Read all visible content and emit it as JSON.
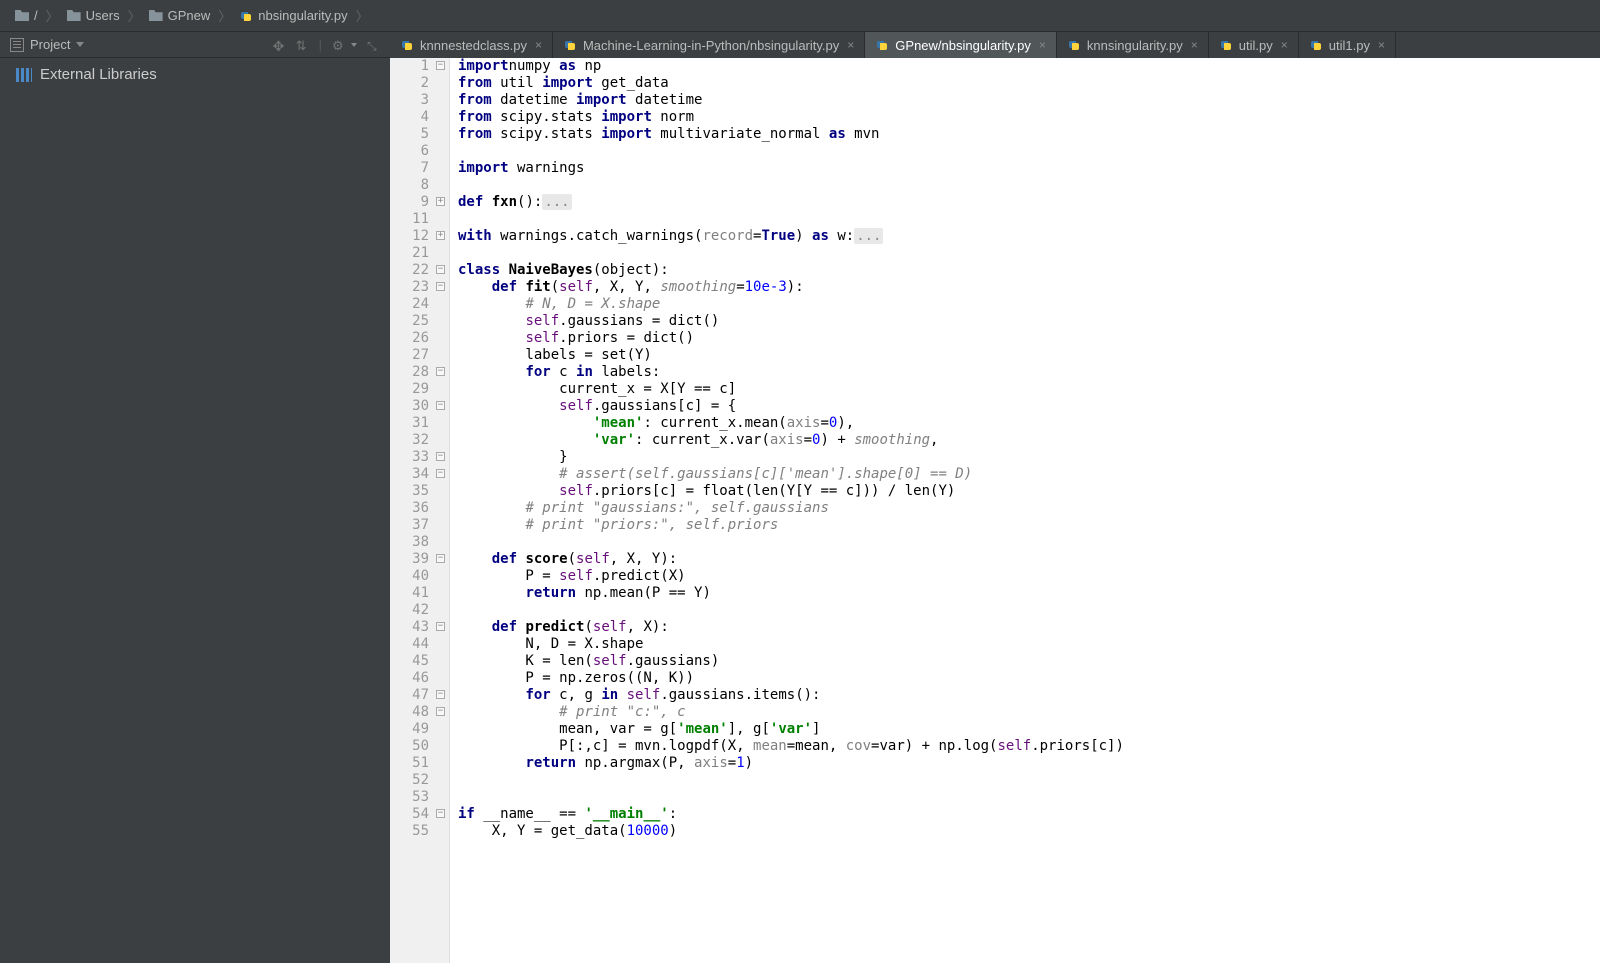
{
  "breadcrumb": [
    {
      "icon": "folder",
      "label": "/"
    },
    {
      "icon": "folder",
      "label": "Users"
    },
    {
      "icon": "folder",
      "label": "GPnew"
    },
    {
      "icon": "py",
      "label": "nbsingularity.py"
    }
  ],
  "sidebar": {
    "header_label": "Project",
    "external_label": "External Libraries"
  },
  "tabs": [
    {
      "label": "knnnestedclass.py",
      "active": false
    },
    {
      "label": "Machine-Learning-in-Python/nbsingularity.py",
      "active": false
    },
    {
      "label": "GPnew/nbsingularity.py",
      "active": true
    },
    {
      "label": "knnsingularity.py",
      "active": false
    },
    {
      "label": "util.py",
      "active": false
    },
    {
      "label": "util1.py",
      "active": false
    }
  ],
  "line_numbers": [
    1,
    2,
    3,
    4,
    5,
    6,
    7,
    8,
    9,
    11,
    12,
    21,
    22,
    23,
    24,
    25,
    26,
    27,
    28,
    29,
    30,
    31,
    32,
    33,
    34,
    35,
    36,
    37,
    38,
    39,
    40,
    41,
    42,
    43,
    44,
    45,
    46,
    47,
    48,
    49,
    50,
    51,
    52,
    53,
    54,
    55
  ],
  "folds": {
    "1": "minus",
    "9": "plus",
    "12": "plus",
    "22": "minus",
    "23": "minus",
    "28": "minus",
    "30": "minus",
    "33": "minus",
    "34": "minus",
    "39": "minus",
    "43": "minus",
    "47": "minus",
    "48": "minus",
    "54": "minus"
  },
  "code": {
    "1": [
      [
        "kw",
        "import"
      ],
      [
        "",
        ", numpy "
      ],
      [
        "kw",
        "as"
      ],
      [
        "",
        " np"
      ]
    ],
    "2": [
      [
        "kw",
        "from"
      ],
      [
        "",
        " util "
      ],
      [
        "kw",
        "import"
      ],
      [
        "",
        " get_data"
      ]
    ],
    "3": [
      [
        "kw",
        "from"
      ],
      [
        "",
        " datetime "
      ],
      [
        "kw",
        "import"
      ],
      [
        "",
        " datetime"
      ]
    ],
    "4": [
      [
        "kw",
        "from"
      ],
      [
        "",
        " scipy.stats "
      ],
      [
        "kw",
        "import"
      ],
      [
        "",
        " norm"
      ]
    ],
    "5": [
      [
        "kw",
        "from"
      ],
      [
        "",
        " scipy.stats "
      ],
      [
        "kw",
        "import"
      ],
      [
        "",
        " multivariate_normal "
      ],
      [
        "kw",
        "as"
      ],
      [
        "",
        " mvn"
      ]
    ],
    "6": [
      [
        "",
        ""
      ]
    ],
    "7": [
      [
        "kw",
        "import"
      ],
      [
        "",
        " warnings"
      ]
    ],
    "8": [
      [
        "",
        ""
      ]
    ],
    "9": [
      [
        "kw",
        "def "
      ],
      [
        "defname",
        "fxn"
      ],
      [
        "",
        "():"
      ],
      [
        "ellip",
        "..."
      ]
    ],
    "11": [
      [
        "",
        ""
      ]
    ],
    "12": [
      [
        "kw",
        "with"
      ],
      [
        "",
        " warnings.catch_warnings("
      ],
      [
        "kwarg",
        "record"
      ],
      [
        "",
        "="
      ],
      [
        "kw",
        "True"
      ],
      [
        "",
        ") "
      ],
      [
        "kw",
        "as"
      ],
      [
        "",
        " w:"
      ],
      [
        "ellip",
        "..."
      ]
    ],
    "21": [
      [
        "",
        ""
      ]
    ],
    "22": [
      [
        "kw",
        "class "
      ],
      [
        "classname",
        "NaiveBayes"
      ],
      [
        "",
        "(object):"
      ]
    ],
    "23": [
      [
        "",
        "    "
      ],
      [
        "kw",
        "def "
      ],
      [
        "defname",
        "fit"
      ],
      [
        "",
        "("
      ],
      [
        "self",
        "self"
      ],
      [
        "",
        ", X, Y, "
      ],
      [
        "param",
        "smoothing"
      ],
      [
        "",
        "="
      ],
      [
        "num",
        "10e-3"
      ],
      [
        "",
        "):"
      ]
    ],
    "24": [
      [
        "",
        "        "
      ],
      [
        "comment",
        "# N, D = X.shape"
      ]
    ],
    "25": [
      [
        "",
        "        "
      ],
      [
        "self",
        "self"
      ],
      [
        "",
        ".gaussians = dict()"
      ]
    ],
    "26": [
      [
        "",
        "        "
      ],
      [
        "self",
        "self"
      ],
      [
        "",
        ".priors = dict()"
      ]
    ],
    "27": [
      [
        "",
        "        labels = set(Y)"
      ]
    ],
    "28": [
      [
        "",
        "        "
      ],
      [
        "kw",
        "for"
      ],
      [
        "",
        " c "
      ],
      [
        "kw",
        "in"
      ],
      [
        "",
        " labels:"
      ]
    ],
    "29": [
      [
        "",
        "            current_x = X[Y == c]"
      ]
    ],
    "30": [
      [
        "",
        "            "
      ],
      [
        "self",
        "self"
      ],
      [
        "",
        ".gaussians[c] = {"
      ]
    ],
    "31": [
      [
        "",
        "                "
      ],
      [
        "str",
        "'mean'"
      ],
      [
        "",
        ": current_x.mean("
      ],
      [
        "kwarg",
        "axis"
      ],
      [
        "",
        "="
      ],
      [
        "num",
        "0"
      ],
      [
        "",
        "),"
      ]
    ],
    "32": [
      [
        "",
        "                "
      ],
      [
        "str",
        "'var'"
      ],
      [
        "",
        ": current_x.var("
      ],
      [
        "kwarg",
        "axis"
      ],
      [
        "",
        "="
      ],
      [
        "num",
        "0"
      ],
      [
        "",
        ") + "
      ],
      [
        "param",
        "smoothing"
      ],
      [
        "",
        ","
      ]
    ],
    "33": [
      [
        "",
        "            }"
      ]
    ],
    "34": [
      [
        "",
        "            "
      ],
      [
        "comment",
        "# assert(self.gaussians[c]['mean'].shape[0] == D)"
      ]
    ],
    "35": [
      [
        "",
        "            "
      ],
      [
        "self",
        "self"
      ],
      [
        "",
        ".priors[c] = float(len(Y[Y == c])) / len(Y)"
      ]
    ],
    "36": [
      [
        "",
        "        "
      ],
      [
        "comment",
        "# print \"gaussians:\", self.gaussians"
      ]
    ],
    "37": [
      [
        "",
        "        "
      ],
      [
        "comment",
        "# print \"priors:\", self.priors"
      ]
    ],
    "38": [
      [
        "",
        ""
      ]
    ],
    "39": [
      [
        "",
        "    "
      ],
      [
        "kw",
        "def "
      ],
      [
        "defname",
        "score"
      ],
      [
        "",
        "("
      ],
      [
        "self",
        "self"
      ],
      [
        "",
        ", X, Y):"
      ]
    ],
    "40": [
      [
        "",
        "        P = "
      ],
      [
        "self",
        "self"
      ],
      [
        "",
        ".predict(X)"
      ]
    ],
    "41": [
      [
        "",
        "        "
      ],
      [
        "kw",
        "return"
      ],
      [
        "",
        " np.mean(P == Y)"
      ]
    ],
    "42": [
      [
        "",
        ""
      ]
    ],
    "43": [
      [
        "",
        "    "
      ],
      [
        "kw",
        "def "
      ],
      [
        "defname",
        "predict"
      ],
      [
        "",
        "("
      ],
      [
        "self",
        "self"
      ],
      [
        "",
        ", X):"
      ]
    ],
    "44": [
      [
        "",
        "        N, D = X.shape"
      ]
    ],
    "45": [
      [
        "",
        "        K = len("
      ],
      [
        "self",
        "self"
      ],
      [
        "",
        ".gaussians)"
      ]
    ],
    "46": [
      [
        "",
        "        P = np.zeros((N, K))"
      ]
    ],
    "47": [
      [
        "",
        "        "
      ],
      [
        "kw",
        "for"
      ],
      [
        "",
        " c, g "
      ],
      [
        "kw",
        "in"
      ],
      [
        "",
        " "
      ],
      [
        "self",
        "self"
      ],
      [
        "",
        ".gaussians.items():"
      ]
    ],
    "48": [
      [
        "",
        "            "
      ],
      [
        "comment",
        "# print \"c:\", c"
      ]
    ],
    "49": [
      [
        "",
        "            mean, var = g["
      ],
      [
        "str",
        "'mean'"
      ],
      [
        "",
        "], g["
      ],
      [
        "str",
        "'var'"
      ],
      [
        "",
        "]"
      ]
    ],
    "50": [
      [
        "",
        "            P[:,c] = mvn.logpdf(X, "
      ],
      [
        "kwarg",
        "mean"
      ],
      [
        "",
        "=mean, "
      ],
      [
        "kwarg",
        "cov"
      ],
      [
        "",
        "=var) + np.log("
      ],
      [
        "self",
        "self"
      ],
      [
        "",
        ".priors[c])"
      ]
    ],
    "51": [
      [
        "",
        "        "
      ],
      [
        "kw",
        "return"
      ],
      [
        "",
        " np.argmax(P, "
      ],
      [
        "kwarg",
        "axis"
      ],
      [
        "",
        "="
      ],
      [
        "num",
        "1"
      ],
      [
        "",
        ")"
      ]
    ],
    "52": [
      [
        "",
        ""
      ]
    ],
    "53": [
      [
        "",
        ""
      ]
    ],
    "54": [
      [
        "kw",
        "if"
      ],
      [
        "",
        " __name__ == "
      ],
      [
        "str",
        "'__main__'"
      ],
      [
        "",
        ":"
      ]
    ],
    "55": [
      [
        "",
        "    X, Y = get_data("
      ],
      [
        "num",
        "10000"
      ],
      [
        "",
        ")"
      ]
    ]
  }
}
